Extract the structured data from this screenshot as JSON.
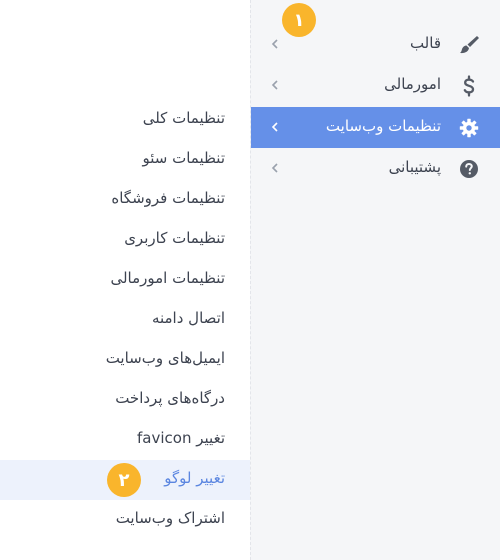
{
  "sidebar": {
    "items": [
      {
        "label": "قالب",
        "icon": "brush-icon"
      },
      {
        "label": "امورمالی",
        "icon": "dollar-icon"
      },
      {
        "label": "تنظیمات وب‌سایت",
        "icon": "gear-icon",
        "active": true,
        "badge": "۱"
      },
      {
        "label": "پشتیبانی",
        "icon": "question-circle-icon"
      }
    ]
  },
  "submenu": {
    "items": [
      {
        "label": "تنظیمات کلی"
      },
      {
        "label": "تنظیمات سئو"
      },
      {
        "label": "تنظیمات فروشگاه"
      },
      {
        "label": "تنظیمات کاربری"
      },
      {
        "label": "تنظیمات امورمالی"
      },
      {
        "label": "اتصال دامنه"
      },
      {
        "label": "ایمیل‌های وب‌سایت"
      },
      {
        "label": "درگاه‌های پرداخت"
      },
      {
        "label": "تغییر favicon"
      },
      {
        "label": "تغییر لوگو",
        "active": true,
        "badge": "۲"
      },
      {
        "label": "اشتراک وب‌سایت"
      }
    ]
  },
  "colors": {
    "accent": "#6590e8",
    "badge": "#f9b52c",
    "sidebar_bg": "#f5f6f8",
    "submenu_active_bg": "#edf2fc",
    "submenu_active_text": "#5b86e0"
  }
}
